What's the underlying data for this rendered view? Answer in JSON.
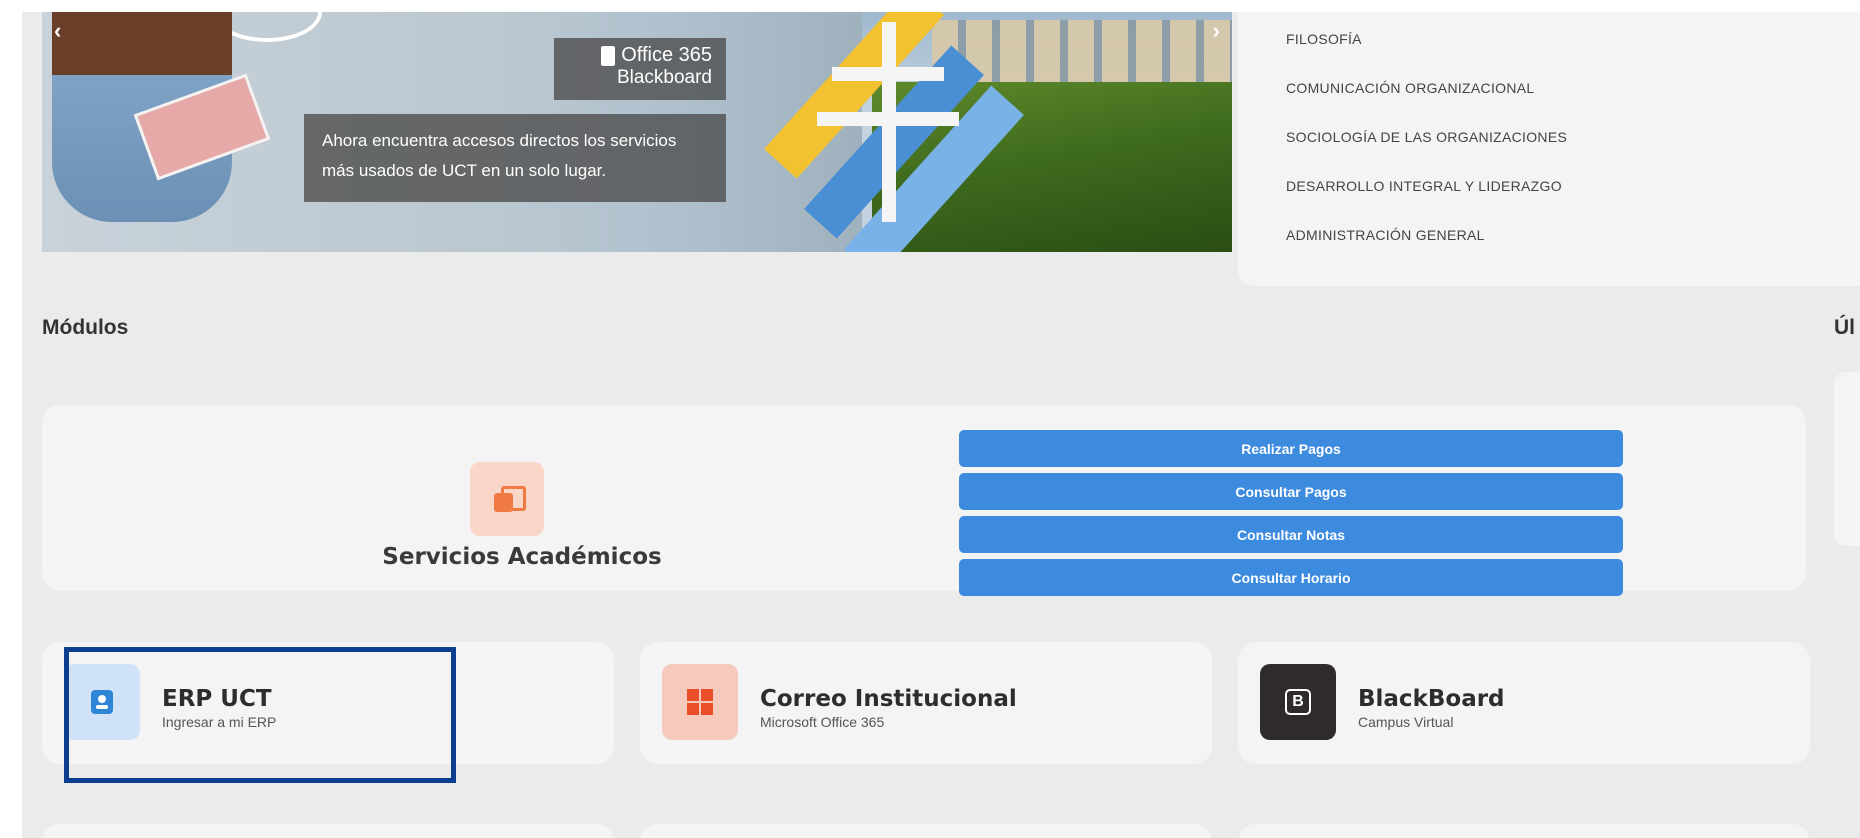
{
  "banner": {
    "office365_label": "Office 365",
    "blackboard_label": "Blackboard",
    "promo_text": "Ahora encuentra accesos directos los servicios más usados de UCT en un solo lugar.",
    "prev_arrow": "‹",
    "next_arrow": "›"
  },
  "courses": {
    "items": [
      "FILOSOFÍA",
      "COMUNICACIÓN ORGANIZACIONAL",
      "SOCIOLOGÍA DE LAS ORGANIZACIONES",
      "DESARROLLO INTEGRAL Y LIDERAZGO",
      "ADMINISTRACIÓN GENERAL"
    ]
  },
  "sections": {
    "modules_title": "Módulos",
    "right_title_partial": "Úl"
  },
  "servicios": {
    "title": "Servicios Académicos",
    "buttons": [
      "Realizar Pagos",
      "Consultar Pagos",
      "Consultar Notas",
      "Consultar Horario"
    ]
  },
  "modules": [
    {
      "title": "ERP UCT",
      "subtitle": "Ingresar a mi ERP",
      "icon": "erp-profile-icon"
    },
    {
      "title": "Correo Institucional",
      "subtitle": "Microsoft Office 365",
      "icon": "microsoft-logo-icon"
    },
    {
      "title": "BlackBoard",
      "subtitle": "Campus Virtual",
      "icon": "blackboard-b-icon",
      "icon_letter": "B"
    }
  ],
  "colors": {
    "accent_blue": "#3d8bdf",
    "highlight_border": "#0b3d91",
    "background": "#ebebeb",
    "card": "#f4f4f4"
  }
}
